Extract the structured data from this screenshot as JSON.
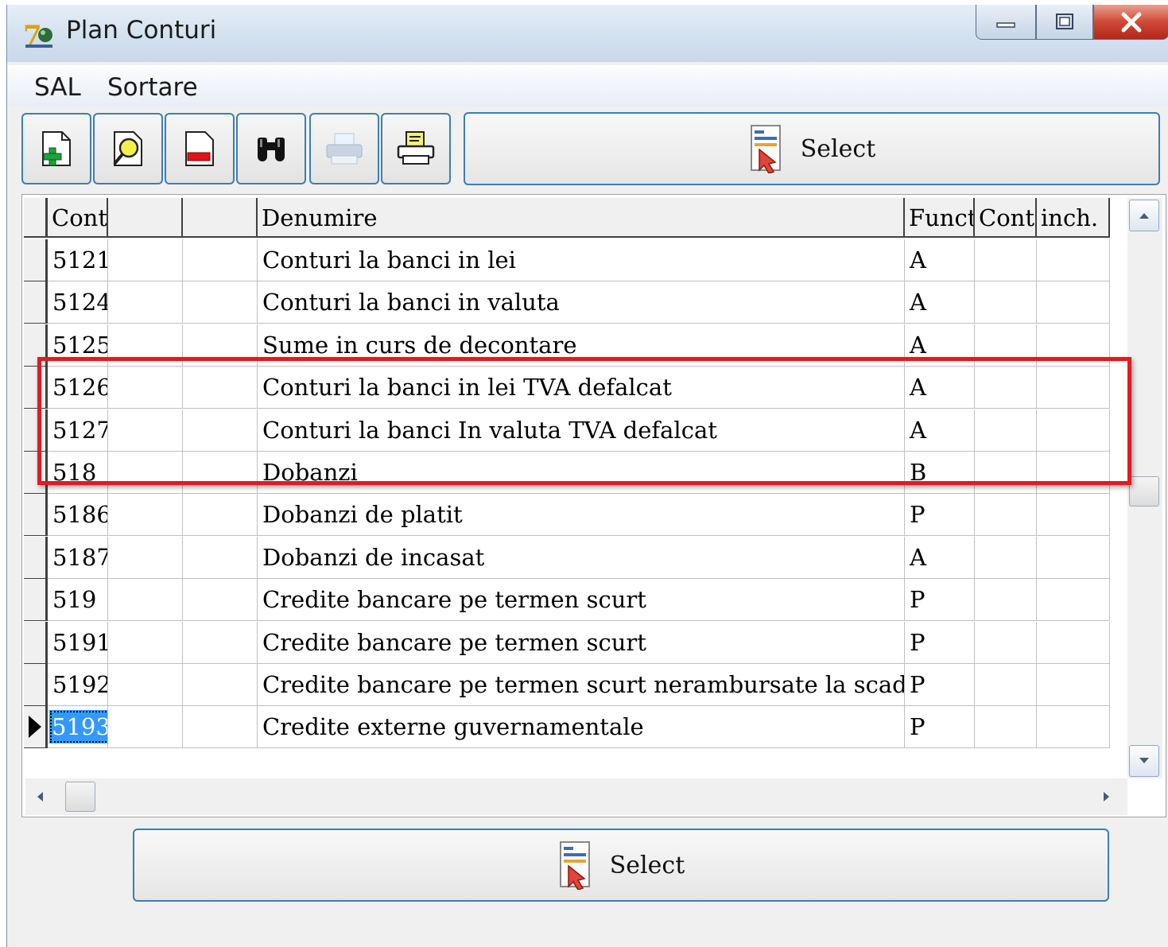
{
  "window": {
    "title": "Plan Conturi"
  },
  "menu": {
    "items": [
      "SAL",
      "Sortare"
    ]
  },
  "toolbar": {
    "buttons": [
      "add-icon",
      "find-icon",
      "delete-icon",
      "binoculars-icon",
      "printer-icon",
      "print-preview-icon"
    ],
    "select_label": "Select"
  },
  "grid": {
    "columns": [
      "Cont",
      "",
      "",
      "Denumire",
      "Funct",
      "Cont",
      "inch."
    ],
    "rows": [
      {
        "cont": "5121",
        "denumire": "Conturi la banci in lei",
        "funct": "A"
      },
      {
        "cont": "5124",
        "denumire": "Conturi la banci in valuta",
        "funct": "A"
      },
      {
        "cont": "5125",
        "denumire": "Sume in curs de decontare",
        "funct": "A"
      },
      {
        "cont": "5126",
        "denumire": "Conturi la banci in lei TVA defalcat",
        "funct": "A"
      },
      {
        "cont": "5127",
        "denumire": "Conturi la banci In valuta TVA defalcat",
        "funct": "A"
      },
      {
        "cont": "518",
        "denumire": "Dobanzi",
        "funct": "B"
      },
      {
        "cont": "5186",
        "denumire": "Dobanzi de platit",
        "funct": "P"
      },
      {
        "cont": "5187",
        "denumire": "Dobanzi de incasat",
        "funct": "A"
      },
      {
        "cont": "519",
        "denumire": "Credite bancare pe termen scurt",
        "funct": "P"
      },
      {
        "cont": "5191",
        "denumire": "Credite bancare pe termen scurt",
        "funct": "P"
      },
      {
        "cont": "5192",
        "denumire": "Credite bancare pe termen scurt nerambursate la scadent",
        "funct": "P"
      },
      {
        "cont": "5193",
        "denumire": "Credite externe guvernamentale",
        "funct": "P"
      }
    ],
    "selected_row": 11
  },
  "footer": {
    "select_label": "Select"
  },
  "colors": {
    "highlight_border": "#e01b22",
    "selection": "#3399ff",
    "button_border": "#3c7fb1"
  }
}
